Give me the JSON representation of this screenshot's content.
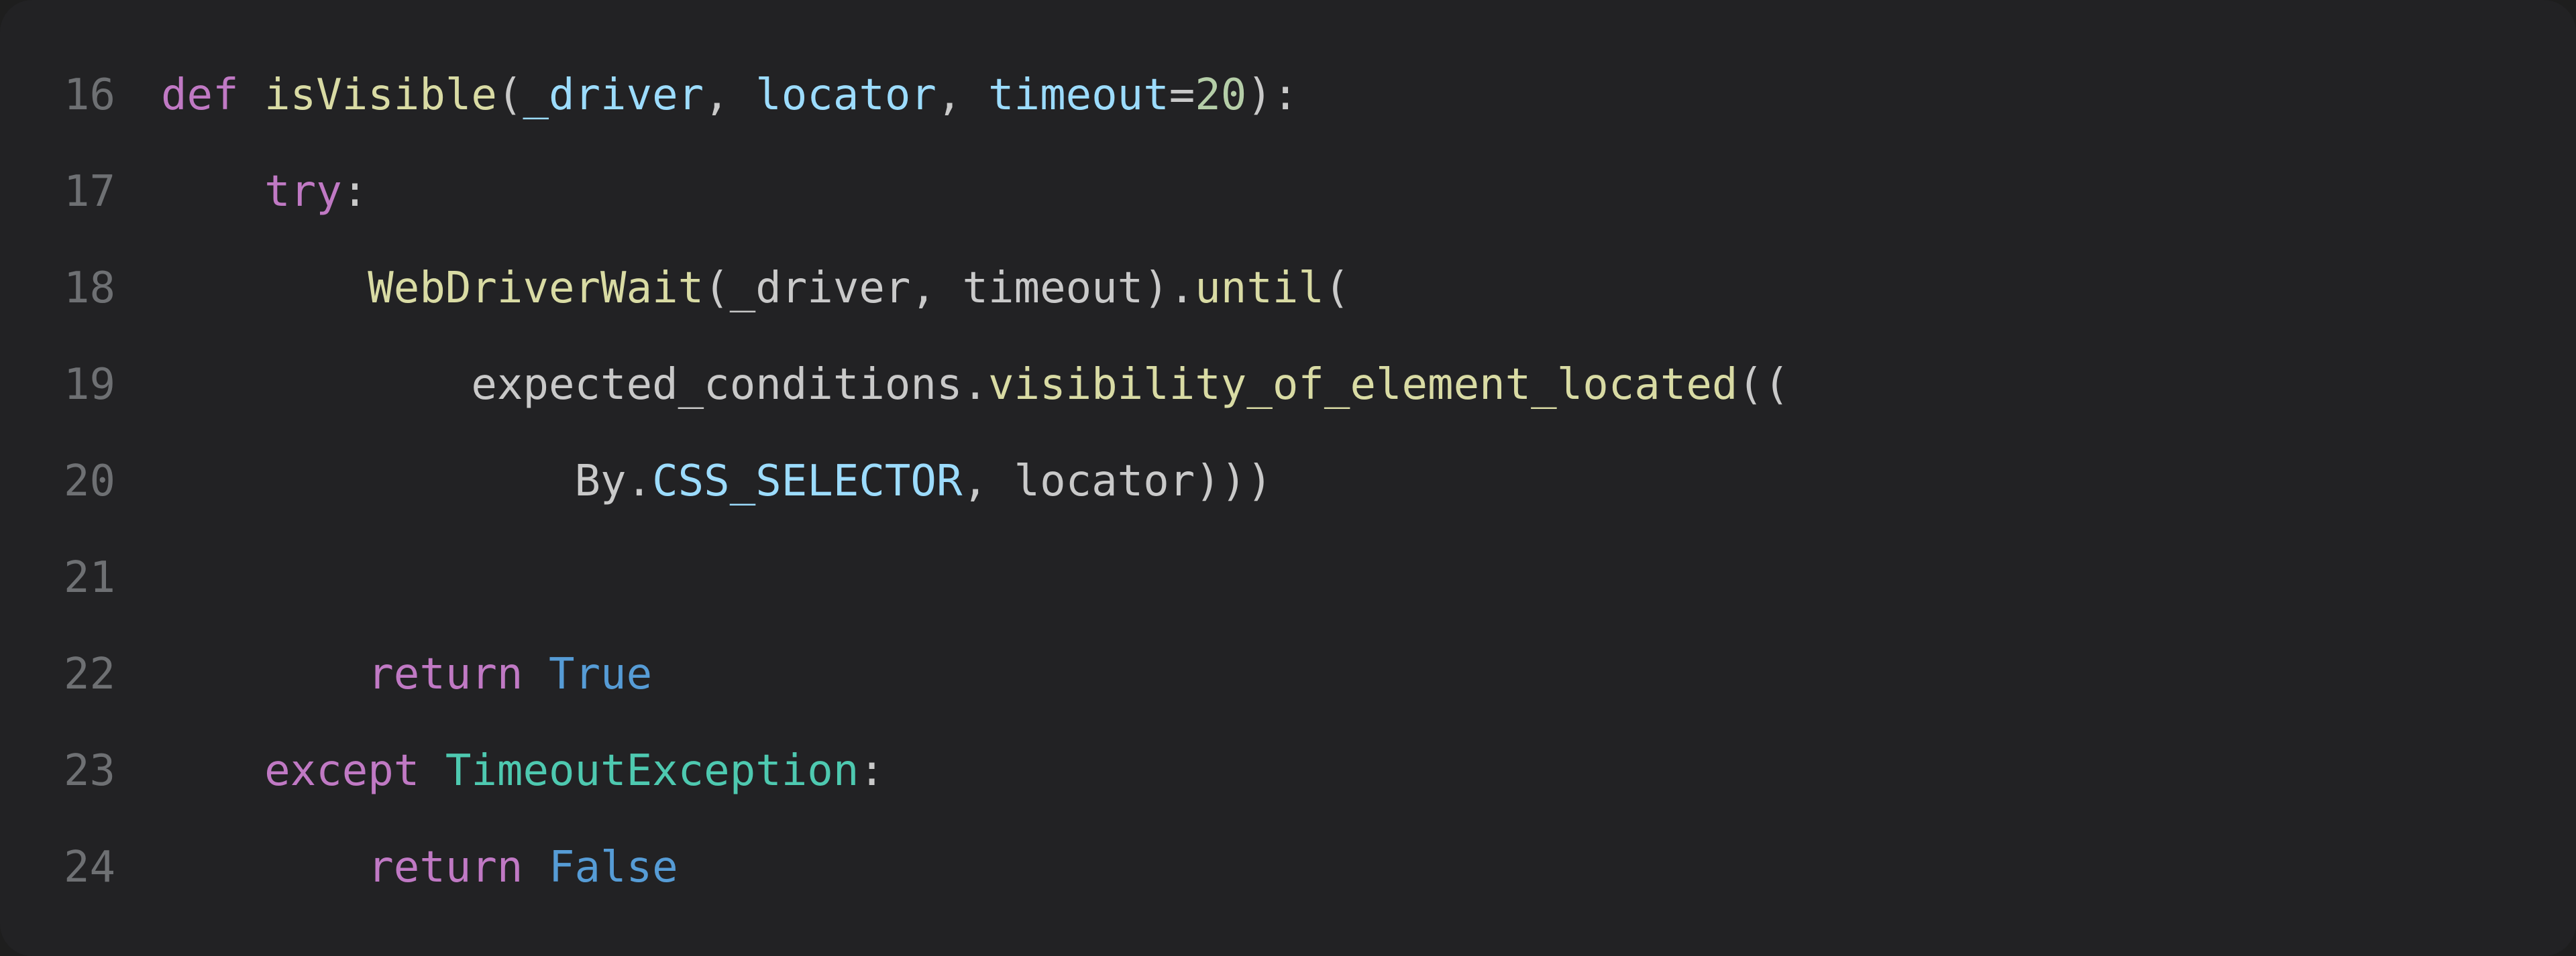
{
  "editor": {
    "language": "python",
    "first_line_number": 16,
    "lines": [
      {
        "num": "16",
        "indent": "",
        "tokens": [
          {
            "cls": "tok-kw",
            "t": "def "
          },
          {
            "cls": "tok-def",
            "t": "isVisible"
          },
          {
            "cls": "tok-punc",
            "t": "("
          },
          {
            "cls": "tok-param",
            "t": "_driver"
          },
          {
            "cls": "tok-punc",
            "t": ", "
          },
          {
            "cls": "tok-param",
            "t": "locator"
          },
          {
            "cls": "tok-punc",
            "t": ", "
          },
          {
            "cls": "tok-param",
            "t": "timeout"
          },
          {
            "cls": "tok-op",
            "t": "="
          },
          {
            "cls": "tok-num",
            "t": "20"
          },
          {
            "cls": "tok-punc",
            "t": "):"
          }
        ]
      },
      {
        "num": "17",
        "indent": "    ",
        "tokens": [
          {
            "cls": "tok-kw",
            "t": "try"
          },
          {
            "cls": "tok-punc",
            "t": ":"
          }
        ]
      },
      {
        "num": "18",
        "indent": "        ",
        "tokens": [
          {
            "cls": "tok-call",
            "t": "WebDriverWait"
          },
          {
            "cls": "tok-punc",
            "t": "("
          },
          {
            "cls": "tok-ident",
            "t": "_driver"
          },
          {
            "cls": "tok-punc",
            "t": ", "
          },
          {
            "cls": "tok-ident",
            "t": "timeout"
          },
          {
            "cls": "tok-punc",
            "t": ")."
          },
          {
            "cls": "tok-call",
            "t": "until"
          },
          {
            "cls": "tok-punc",
            "t": "("
          }
        ]
      },
      {
        "num": "19",
        "indent": "            ",
        "tokens": [
          {
            "cls": "tok-ident",
            "t": "expected_conditions"
          },
          {
            "cls": "tok-punc",
            "t": "."
          },
          {
            "cls": "tok-call",
            "t": "visibility_of_element_located"
          },
          {
            "cls": "tok-punc",
            "t": "(("
          }
        ]
      },
      {
        "num": "20",
        "indent": "                ",
        "tokens": [
          {
            "cls": "tok-ident",
            "t": "By"
          },
          {
            "cls": "tok-punc",
            "t": "."
          },
          {
            "cls": "tok-prop",
            "t": "CSS_SELECTOR"
          },
          {
            "cls": "tok-punc",
            "t": ", "
          },
          {
            "cls": "tok-ident",
            "t": "locator"
          },
          {
            "cls": "tok-punc",
            "t": ")))"
          }
        ]
      },
      {
        "num": "21",
        "indent": "",
        "tokens": []
      },
      {
        "num": "22",
        "indent": "        ",
        "tokens": [
          {
            "cls": "tok-kw",
            "t": "return "
          },
          {
            "cls": "tok-const",
            "t": "True"
          }
        ]
      },
      {
        "num": "23",
        "indent": "    ",
        "tokens": [
          {
            "cls": "tok-kw",
            "t": "except "
          },
          {
            "cls": "tok-type",
            "t": "TimeoutException"
          },
          {
            "cls": "tok-punc",
            "t": ":"
          }
        ]
      },
      {
        "num": "24",
        "indent": "        ",
        "tokens": [
          {
            "cls": "tok-kw",
            "t": "return "
          },
          {
            "cls": "tok-const",
            "t": "False"
          }
        ]
      }
    ]
  }
}
